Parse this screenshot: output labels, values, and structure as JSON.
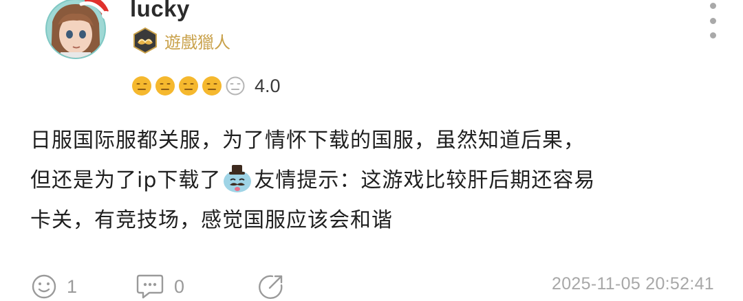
{
  "user": {
    "name": "lucky",
    "badge_label": "遊戲獵人"
  },
  "rating": {
    "filled": 4,
    "total": 5,
    "value": "4.0",
    "filled_color": "#f5b82e",
    "empty_color": "#b5b5b5"
  },
  "review": {
    "line1": "日服国际服都关服，为了情怀下载的国服，虽然知道后果，",
    "line2_before": "但还是为了ip下载了",
    "line2_emoji": "gentleman-face-emoji",
    "line2_after": "友情提示：这游戏比较肝后期还容易",
    "line3": "卡关，有竞技场，感觉国服应该会和谐"
  },
  "actions": {
    "like_count": "1",
    "comment_count": "0"
  },
  "timestamp": "2025-11-05 20:52:41",
  "colors": {
    "accent_gold": "#c9a14a",
    "muted_icon": "#9a9a9a"
  }
}
